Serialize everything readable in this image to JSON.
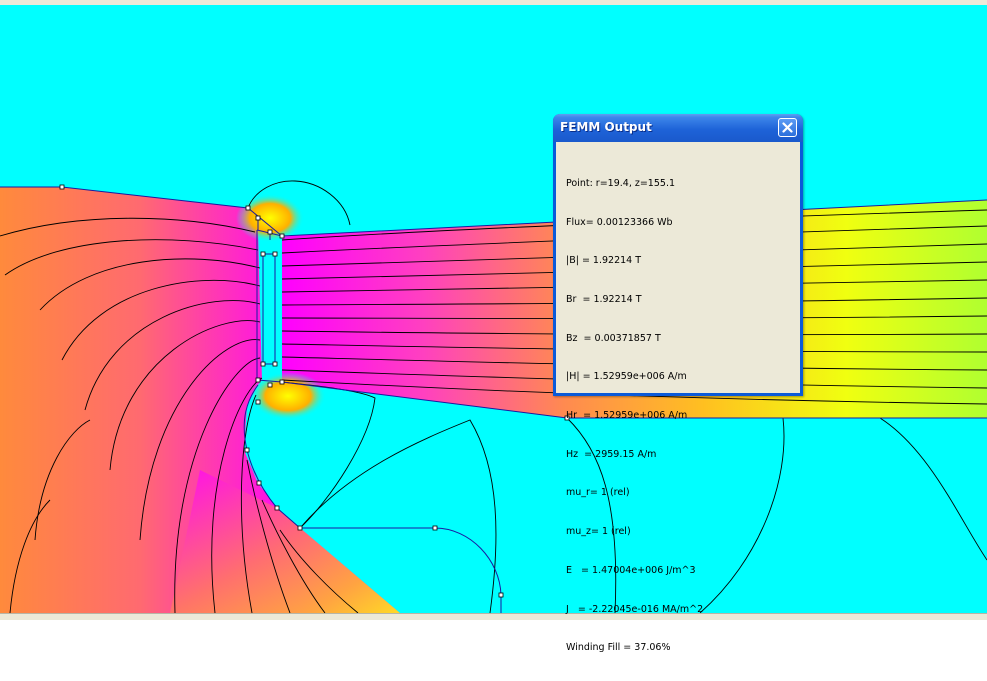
{
  "window": {
    "title": "FEMM Output",
    "close_label": "×"
  },
  "readout": {
    "lines": [
      "Point: r=19.4, z=155.1",
      "Flux= 0.00123366 Wb",
      "|B| = 1.92214 T",
      "Br  = 1.92214 T",
      "Bz  = 0.00371857 T",
      "|H| = 1.52959e+006 A/m",
      "Hr  = 1.52959e+006 A/m",
      "Hz  = 2959.15 A/m",
      "mu_r= 1 (rel)",
      "mu_z= 1 (rel)",
      "E   = 1.47004e+006 J/m^3",
      "J   = -2.22045e-016 MA/m^2",
      "Winding Fill = 37.06%"
    ]
  },
  "colors": {
    "air": "#00ffff",
    "high_field": "#ff00ff",
    "mid_field": "#ff8040",
    "low_field": "#ffff00",
    "outline": "#000080",
    "flux_line": "#000000"
  },
  "icons": {
    "close": "close-icon"
  }
}
